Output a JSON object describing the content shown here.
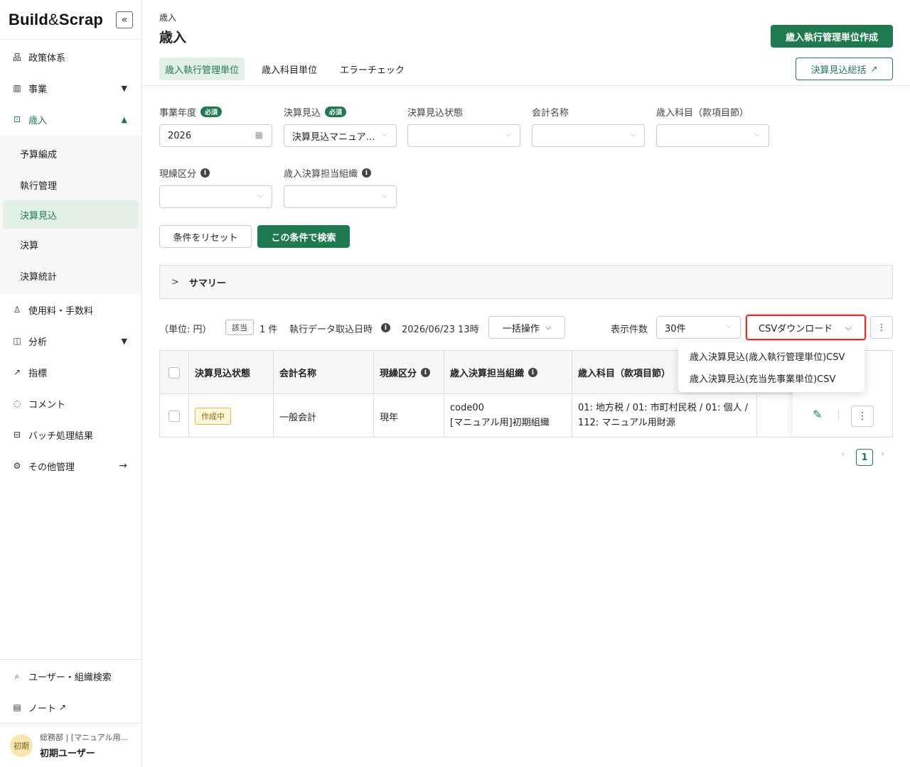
{
  "app": {
    "logo_left": "Build",
    "logo_amp": "&",
    "logo_right": "Scrap",
    "collapse": "«"
  },
  "sidebar": {
    "items": [
      {
        "label": "政策体系",
        "icon": "hierarchy-icon"
      },
      {
        "label": "事業",
        "icon": "bar-chart-icon",
        "chevron": "down"
      },
      {
        "label": "歳入",
        "icon": "revenue-icon",
        "chevron": "up",
        "active": true
      },
      {
        "label": "使用料・手数料",
        "icon": "fee-icon"
      },
      {
        "label": "分析",
        "icon": "analysis-icon",
        "chevron": "down"
      },
      {
        "label": "指標",
        "icon": "trend-icon"
      },
      {
        "label": "コメント",
        "icon": "comment-icon"
      },
      {
        "label": "バッチ処理結果",
        "icon": "batch-icon"
      },
      {
        "label": "その他管理",
        "icon": "settings-icon",
        "chevron": "right"
      }
    ],
    "sub_items": [
      "予算編成",
      "執行管理",
      "決算見込",
      "決算",
      "決算統計"
    ],
    "bottom": [
      {
        "label": "ユーザー・組織検索",
        "icon": "search-icon"
      },
      {
        "label": "ノート",
        "icon": "notebook-icon"
      }
    ],
    "user": {
      "avatar": "初期",
      "dept": "総務部 | [マニュアル用]初期組織",
      "name": "初期ユーザー"
    }
  },
  "header": {
    "breadcrumb": "歳入",
    "title": "歳入",
    "create_button": "歳入執行管理単位作成",
    "summary_button": "決算見込総括"
  },
  "tabs": [
    "歳入執行管理単位",
    "歳入科目単位",
    "エラーチェック"
  ],
  "filters": {
    "fiscal_year": {
      "label": "事業年度",
      "badge": "必須",
      "value": "2026"
    },
    "estimate": {
      "label": "決算見込",
      "badge": "必須",
      "value": "決算見込マニュアル用"
    },
    "estimate_status": {
      "label": "決算見込状態",
      "value": ""
    },
    "account_name": {
      "label": "会計名称",
      "value": ""
    },
    "revenue_item": {
      "label": "歳入科目（款項目節）",
      "value": ""
    },
    "current_category": {
      "label": "現繰区分",
      "value": ""
    },
    "org": {
      "label": "歳入決算担当組織",
      "value": ""
    },
    "reset_button": "条件をリセット",
    "search_button": "この条件で検索"
  },
  "summary": {
    "label": "サマリー"
  },
  "toolbar": {
    "unit": "（単位: 円）",
    "hit_badge": "該当",
    "count": "1 件",
    "import_label": "執行データ取込日時",
    "import_value": "2026/06/23 13時",
    "bulk_button": "一括操作",
    "per_page_label": "表示件数",
    "per_page_value": "30件",
    "csv_button": "CSVダウンロード",
    "csv_options": [
      "歳入決算見込(歳入執行管理単位)CSV",
      "歳入決算見込(充当先事業単位)CSV"
    ]
  },
  "table": {
    "headers": [
      "決算見込状態",
      "会計名称",
      "現繰区分",
      "歳入決算担当組織",
      "歳入科目（款項目節）"
    ],
    "rows": [
      {
        "status": "作成中",
        "account": "一般会計",
        "category": "現年",
        "org_line1": "code00",
        "org_line2": "[マニュアル用]初期組織",
        "item_line1": "01: 地方税 / 01: 市町村民税 / 01: 個人 /",
        "item_line2": "112: マニュアル用財源"
      }
    ]
  },
  "pagination": {
    "current": "1",
    "prev": "‹",
    "next": "›"
  },
  "colors": {
    "accent": "#1f7a4f",
    "highlight": "#d33333",
    "status_bg": "#fff7d9"
  }
}
